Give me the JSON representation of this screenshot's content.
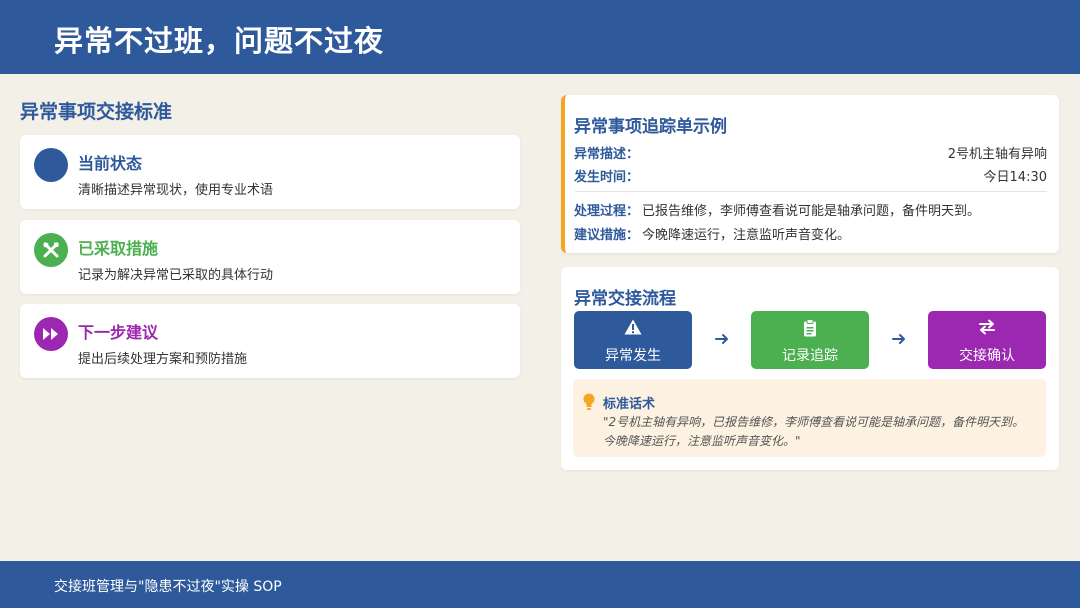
{
  "header": {
    "title": "异常不过班，问题不过夜"
  },
  "footer": {
    "text": "交接班管理与\"隐患不过夜\"实操 SOP"
  },
  "left": {
    "section_title": "异常事项交接标准",
    "cards": [
      {
        "title": "当前状态",
        "desc": "清晰描述异常现状，使用专业术语",
        "color": "#2e5a9c",
        "icon": "circle-icon"
      },
      {
        "title": "已采取措施",
        "desc": "记录为解决异常已采取的具体行动",
        "color": "#4caf50",
        "icon": "tools-icon"
      },
      {
        "title": "下一步建议",
        "desc": "提出后续处理方案和预防措施",
        "color": "#9c27b0",
        "icon": "fast-forward-icon"
      }
    ]
  },
  "tracker": {
    "title": "异常事项追踪单示例",
    "desc_label": "异常描述：",
    "desc_value": "2号机主轴有异响",
    "time_label": "发生时间：",
    "time_value": "今日14:30",
    "process_label": "处理过程：",
    "process_value": "已报告维修，李师傅查看说可能是轴承问题，备件明天到。",
    "suggest_label": "建议措施：",
    "suggest_value": "今晚降速运行，注意监听声音变化。",
    "accent_color": "#f5a524"
  },
  "flow": {
    "title": "异常交接流程",
    "steps": [
      {
        "label": "异常发生",
        "color": "#2e5a9c",
        "icon": "warning-icon"
      },
      {
        "label": "记录追踪",
        "color": "#4caf50",
        "icon": "clipboard-icon"
      },
      {
        "label": "交接确认",
        "color": "#9c27b0",
        "icon": "exchange-icon"
      }
    ],
    "quote_title": "标准话术",
    "quote_text": "\"2号机主轴有异响，已报告维修，李师傅查看说可能是轴承问题，备件明天到。今晚降速运行，注意监听声音变化。\"",
    "quote_icon": "lightbulb-icon"
  }
}
